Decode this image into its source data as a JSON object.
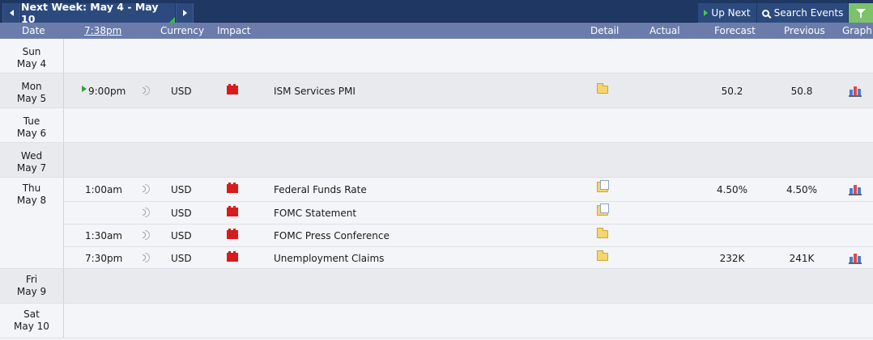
{
  "toolbar": {
    "week_label": "Next Week: May 4 - May 10",
    "up_next_label": "Up Next",
    "search_label": "Search Events"
  },
  "columns": {
    "date": "Date",
    "time": "7:38pm",
    "currency": "Currency",
    "impact": "Impact",
    "detail": "Detail",
    "actual": "Actual",
    "forecast": "Forecast",
    "previous": "Previous",
    "graph": "Graph"
  },
  "days": [
    {
      "weekday": "Sun",
      "date": "May 4",
      "events": []
    },
    {
      "weekday": "Mon",
      "date": "May 5",
      "events": [
        {
          "time": "9:00pm",
          "upcoming": true,
          "currency": "USD",
          "impact": "high",
          "name": "ISM Services PMI",
          "detail": "folder",
          "actual": "",
          "forecast": "50.2",
          "previous": "50.8",
          "graph": true
        }
      ]
    },
    {
      "weekday": "Tue",
      "date": "May 6",
      "events": []
    },
    {
      "weekday": "Wed",
      "date": "May 7",
      "events": []
    },
    {
      "weekday": "Thu",
      "date": "May 8",
      "events": [
        {
          "time": "1:00am",
          "currency": "USD",
          "impact": "high",
          "name": "Federal Funds Rate",
          "detail": "folder-doc",
          "actual": "",
          "forecast": "4.50%",
          "previous": "4.50%",
          "graph": true
        },
        {
          "time": "",
          "currency": "USD",
          "impact": "high",
          "name": "FOMC Statement",
          "detail": "folder-doc",
          "actual": "",
          "forecast": "",
          "previous": "",
          "graph": false
        },
        {
          "time": "1:30am",
          "currency": "USD",
          "impact": "high",
          "name": "FOMC Press Conference",
          "detail": "folder",
          "actual": "",
          "forecast": "",
          "previous": "",
          "graph": false
        },
        {
          "time": "7:30pm",
          "currency": "USD",
          "impact": "high",
          "name": "Unemployment Claims",
          "detail": "folder",
          "actual": "",
          "forecast": "232K",
          "previous": "241K",
          "graph": true
        }
      ]
    },
    {
      "weekday": "Fri",
      "date": "May 9",
      "events": []
    },
    {
      "weekday": "Sat",
      "date": "May 10",
      "events": []
    }
  ],
  "colors": {
    "high_impact": "#d91b1b",
    "toolbar": "#1f3763",
    "header": "#6b7cab"
  }
}
